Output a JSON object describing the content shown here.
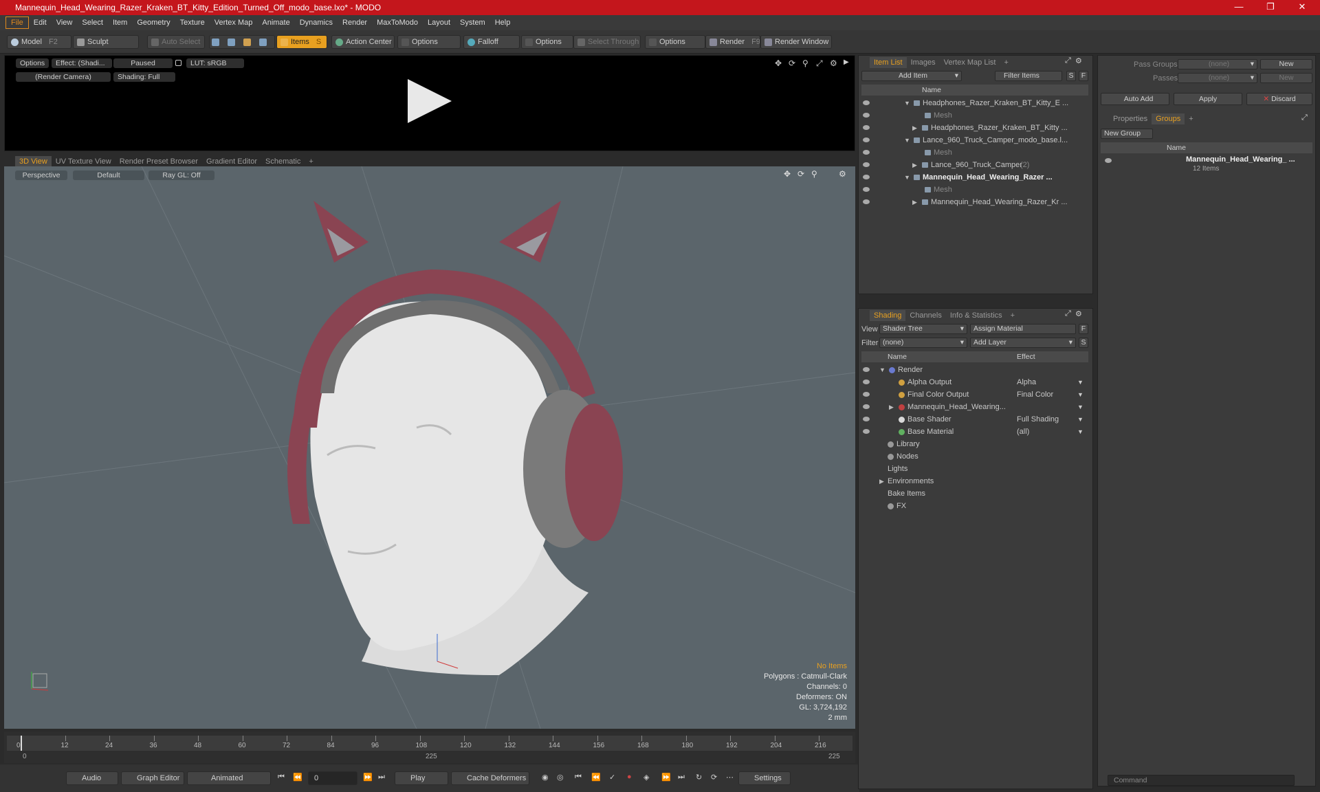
{
  "window": {
    "title": "Mannequin_Head_Wearing_Razer_Kraken_BT_Kitty_Edition_Turned_Off_modo_base.lxo* - MODO",
    "minimize": "—",
    "maximize": "❐",
    "close": "✕"
  },
  "menu": [
    "File",
    "Edit",
    "View",
    "Select",
    "Item",
    "Geometry",
    "Texture",
    "Vertex Map",
    "Animate",
    "Dynamics",
    "Render",
    "MaxToModo",
    "Layout",
    "System",
    "Help"
  ],
  "toolbar": {
    "model": "Model",
    "model_key": "F2",
    "sculpt": "Sculpt",
    "auto_select": "Auto Select",
    "items": "Items",
    "items_key": "S",
    "action_center": "Action Center",
    "options1": "Options",
    "falloff": "Falloff",
    "options2": "Options",
    "select_through": "Select Through",
    "options3": "Options",
    "render": "Render",
    "render_key": "F9",
    "render_window": "Render Window"
  },
  "render_preview": {
    "options": "Options",
    "effect": "Effect: (Shadi...",
    "paused": "Paused",
    "lut": "LUT: sRGB",
    "camera": "(Render Camera)",
    "shading": "Shading: Full"
  },
  "viewport_tabs": [
    "3D View",
    "UV Texture View",
    "Render Preset Browser",
    "Gradient Editor",
    "Schematic",
    "+"
  ],
  "viewport": {
    "projection": "Perspective",
    "style": "Default",
    "raygl": "Ray GL: Off",
    "info": {
      "items": "No Items",
      "polygons": "Polygons : Catmull-Clark",
      "channels": "Channels: 0",
      "deformers": "Deformers: ON",
      "gl": "GL: 3,724,192",
      "scale": "2 mm"
    }
  },
  "timeline": {
    "ticks": [
      "0",
      "12",
      "24",
      "36",
      "48",
      "60",
      "72",
      "84",
      "96",
      "108",
      "120",
      "132",
      "144",
      "156",
      "168",
      "180",
      "192",
      "204",
      "216"
    ],
    "start": "0",
    "mid": "225",
    "end": "225"
  },
  "bottombar": {
    "audio": "Audio",
    "graph_editor": "Graph Editor",
    "animated": "Animated",
    "frame": "0",
    "play": "Play",
    "cache": "Cache Deformers",
    "settings": "Settings"
  },
  "itemlist": {
    "tabs": [
      "Item List",
      "Images",
      "Vertex Map List",
      "+"
    ],
    "add_item": "Add Item",
    "filter": "Filter Items",
    "s": "S",
    "f": "F",
    "col_name": "Name",
    "rows": [
      {
        "label": "Headphones_Razer_Kraken_BT_Kitty_E ...",
        "indent": 80,
        "type": "group"
      },
      {
        "label": "Mesh",
        "indent": 96,
        "type": "dim"
      },
      {
        "label": "Headphones_Razer_Kraken_BT_Kitty ...",
        "indent": 92,
        "type": "item"
      },
      {
        "label": "Lance_960_Truck_Camper_modo_base.l...",
        "indent": 80,
        "type": "group"
      },
      {
        "label": "Mesh",
        "indent": 96,
        "type": "dim"
      },
      {
        "label": "Lance_960_Truck_Camper",
        "count": "(2)",
        "indent": 92,
        "type": "item"
      },
      {
        "label": "Mannequin_Head_Wearing_Razer ...",
        "indent": 80,
        "type": "bold"
      },
      {
        "label": "Mesh",
        "indent": 96,
        "type": "dim"
      },
      {
        "label": "Mannequin_Head_Wearing_Razer_Kr ...",
        "indent": 92,
        "type": "item"
      }
    ]
  },
  "shading": {
    "tabs": [
      "Shading",
      "Channels",
      "Info & Statistics",
      "+"
    ],
    "view_label": "View",
    "view_value": "Shader Tree",
    "assign": "Assign Material",
    "f": "F",
    "filter_label": "Filter",
    "filter_value": "(none)",
    "add_layer": "Add Layer",
    "s": "S",
    "col_name": "Name",
    "col_effect": "Effect",
    "rows": [
      {
        "label": "Render",
        "effect": "",
        "indent": 30
      },
      {
        "label": "Alpha Output",
        "effect": "Alpha",
        "indent": 44
      },
      {
        "label": "Final Color Output",
        "effect": "Final Color",
        "indent": 44
      },
      {
        "label": "Mannequin_Head_Wearing...",
        "effect": "",
        "indent": 44
      },
      {
        "label": "Base Shader",
        "effect": "Full Shading",
        "indent": 44
      },
      {
        "label": "Base Material",
        "effect": "(all)",
        "indent": 44
      },
      {
        "label": "Library",
        "effect": "",
        "indent": 30
      },
      {
        "label": "Nodes",
        "effect": "",
        "indent": 30
      },
      {
        "label": "Lights",
        "effect": "",
        "indent": 30
      },
      {
        "label": "Environments",
        "effect": "",
        "indent": 30
      },
      {
        "label": "Bake Items",
        "effect": "",
        "indent": 30
      },
      {
        "label": "FX",
        "effect": "",
        "indent": 30
      }
    ]
  },
  "passes": {
    "pass_groups": "Pass Groups",
    "pass_groups_value": "(none)",
    "new1": "New",
    "passes": "Passes",
    "passes_value": "(none)",
    "new2": "New",
    "auto_add": "Auto Add",
    "apply": "Apply",
    "discard": "Discard"
  },
  "groups": {
    "tabs": [
      "Properties",
      "Groups",
      "+"
    ],
    "new_group": "New Group",
    "col_name": "Name",
    "item_label": "Mannequin_Head_Wearing_ ...",
    "item_count": "12 Items"
  },
  "command": {
    "placeholder": "Command"
  },
  "colors": {
    "accent": "#e8a020",
    "title": "#c4161c",
    "headphone": "#8a4452"
  }
}
